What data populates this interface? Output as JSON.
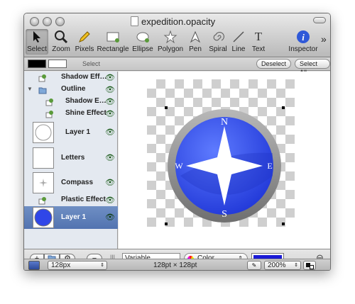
{
  "window": {
    "title": "expedition.opacity"
  },
  "toolbar": {
    "tools": [
      {
        "label": "Select",
        "icon": "arrow-cursor-icon",
        "selected": true
      },
      {
        "label": "Zoom",
        "icon": "magnifier-icon"
      },
      {
        "label": "Pixels",
        "icon": "pencil-icon"
      },
      {
        "label": "Rectangle",
        "icon": "rectangle-icon"
      },
      {
        "label": "Ellipse",
        "icon": "ellipse-icon"
      },
      {
        "label": "Polygon",
        "icon": "polygon-star-icon"
      },
      {
        "label": "Pen",
        "icon": "pen-icon"
      },
      {
        "label": "Spiral",
        "icon": "spiral-icon"
      },
      {
        "label": "Line",
        "icon": "line-icon"
      },
      {
        "label": "Text",
        "icon": "text-icon"
      },
      {
        "label": "Inspector",
        "icon": "info-icon"
      }
    ],
    "overflow": "»"
  },
  "optionsbar": {
    "mode_label": "Select",
    "fill_color": "#000000",
    "stroke_color": "#ffffff",
    "deselect_label": "Deselect",
    "select_all_label": "Select All"
  },
  "layers": [
    {
      "name": "Shadow Eff…",
      "kind": "effect"
    },
    {
      "name": "Outline",
      "kind": "folder"
    },
    {
      "name": "Shadow E…",
      "kind": "effect"
    },
    {
      "name": "Shine Effect",
      "kind": "effect"
    },
    {
      "name": "Layer 1",
      "kind": "layer"
    },
    {
      "name": "Letters",
      "kind": "layer"
    },
    {
      "name": "Compass",
      "kind": "layer"
    },
    {
      "name": "Plastic Effect",
      "kind": "effect"
    },
    {
      "name": "Layer 1",
      "kind": "layer",
      "selected": true
    }
  ],
  "canvas": {
    "compass_letters": {
      "n": "N",
      "e": "E",
      "s": "S",
      "w": "W"
    },
    "colors": {
      "ring": "#8e8e8e",
      "face": "#2f46e8",
      "face_light": "#5e7bff",
      "star": "#ffffff"
    }
  },
  "bottom": {
    "add_label": "+",
    "remove_label": "−",
    "variable_field": "Variable",
    "color_mode": "Color",
    "color_swatch": "#1a1ad6",
    "stepper": "⊖"
  },
  "status": {
    "size_select": "128px",
    "dimensions": "128pt × 128pt",
    "zoom": "200%"
  }
}
